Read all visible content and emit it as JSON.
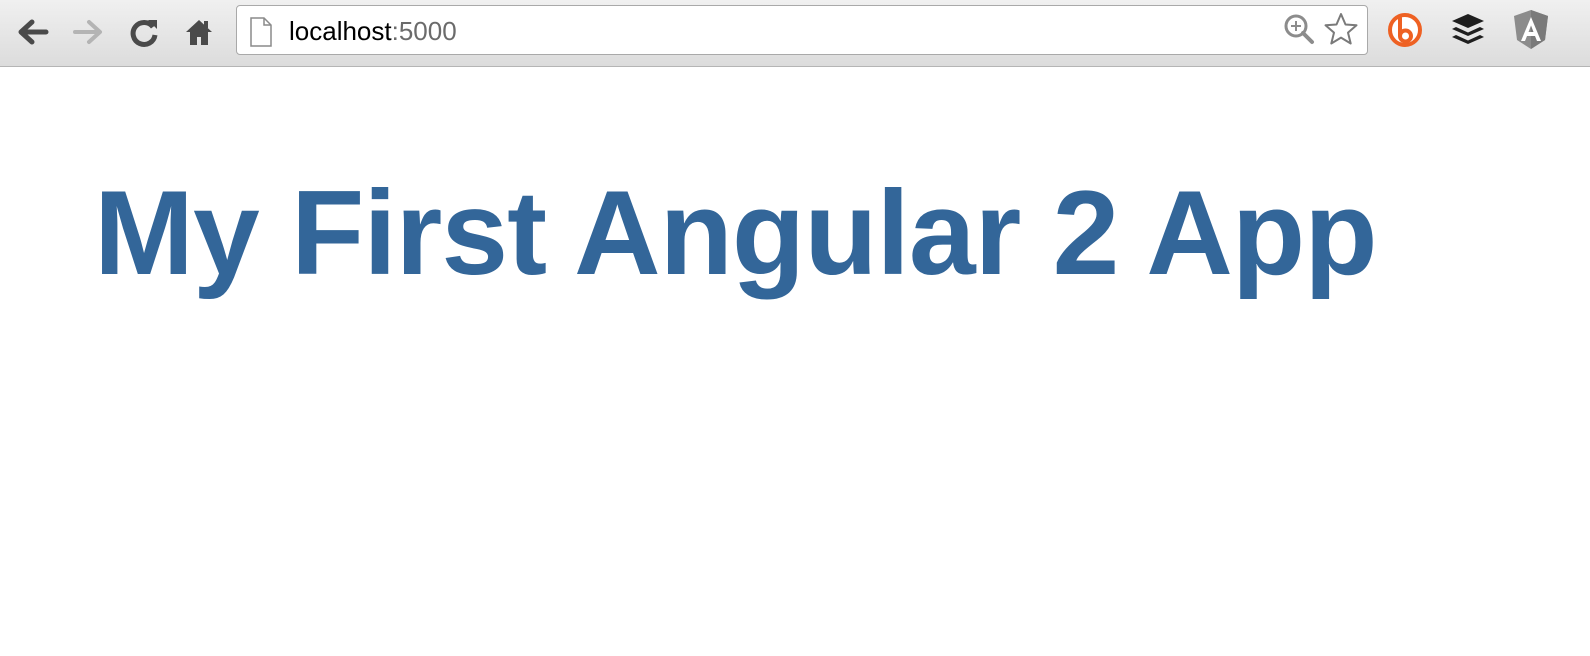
{
  "browser": {
    "address_bar": {
      "host": "localhost",
      "port": ":5000"
    },
    "icons": {
      "back": "back-arrow-icon",
      "forward": "forward-arrow-icon",
      "reload": "reload-icon",
      "home": "home-icon",
      "page": "page-icon",
      "zoom": "zoom-in-icon",
      "bookmark": "star-icon",
      "extension_1": "bitly-icon",
      "extension_2": "buffer-icon",
      "extension_3": "angular-icon"
    },
    "forward_enabled": false
  },
  "page": {
    "heading": "My First Angular 2 App",
    "heading_color": "#336699"
  }
}
